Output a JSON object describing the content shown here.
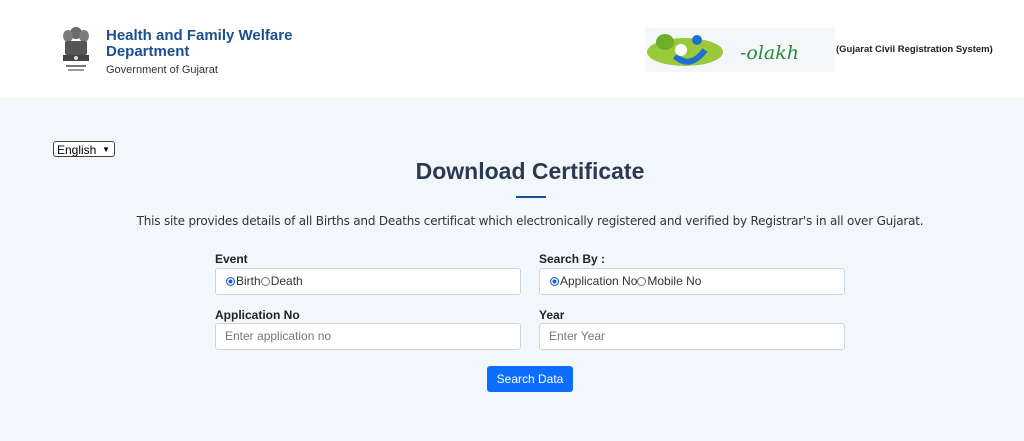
{
  "header": {
    "dept_line1": "Health and Family Welfare",
    "dept_line2": "Department",
    "dept_line3": "Government of Gujarat",
    "olakh_logo_text": "-olakh",
    "system_name": "(Gujarat Civil Registration System)"
  },
  "language": {
    "selected": "English"
  },
  "page": {
    "title": "Download Certificate",
    "description": "This site provides details of all Births and Deaths certificat which electronically registered and verified by Registrar's in all over Gujarat."
  },
  "form": {
    "event_label": "Event",
    "event_options": [
      "Birth",
      "Death"
    ],
    "event_selected": "Birth",
    "searchby_label": "Search By :",
    "searchby_options": [
      "Application No",
      "Mobile No"
    ],
    "searchby_selected": "Application No",
    "appno_label": "Application No",
    "appno_placeholder": "Enter application no",
    "year_label": "Year",
    "year_placeholder": "Enter Year",
    "submit_label": "Search Data"
  },
  "colors": {
    "primary_button": "#0d6efd",
    "title": "#2b3a52",
    "brand_blue": "#1d4f8f",
    "page_bg": "#f2f7fc"
  },
  "icons": [
    "national-emblem-icon",
    "olakh-logo-icon",
    "radio-icon",
    "chevron-down-icon"
  ]
}
